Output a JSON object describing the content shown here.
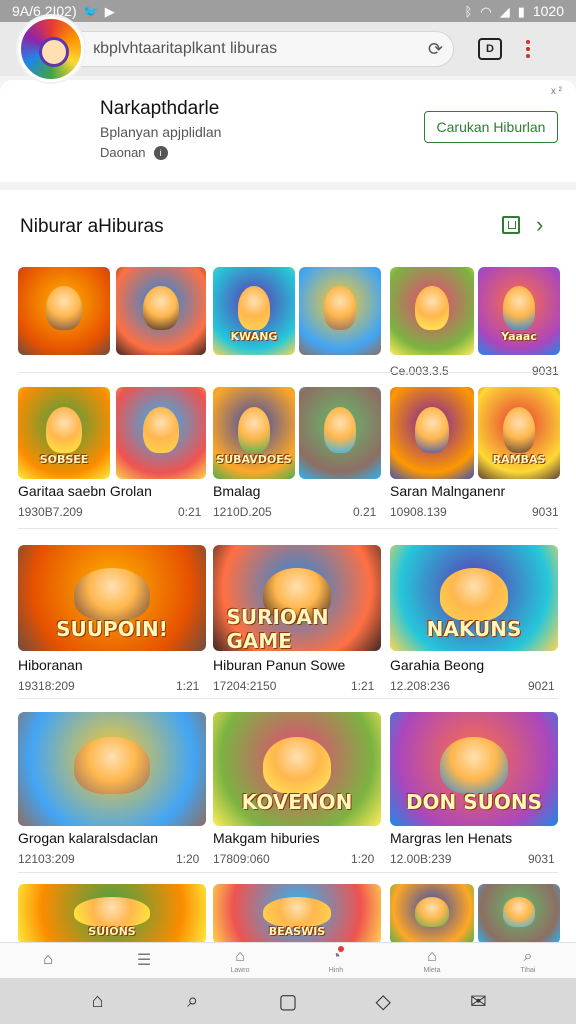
{
  "status_bar": {
    "time": "9A/6 2I02)",
    "right_text": "1020",
    "icons": [
      "twitter-icon",
      "youtube-icon",
      "bluetooth-icon",
      "wifi-icon",
      "signal-icon",
      "battery-icon"
    ]
  },
  "browser": {
    "url_text": "кbplvhtaaritaplkant liburas"
  },
  "app_card": {
    "name": "Narkapthdarle",
    "subtitle": "Bplanyan apjplidlan",
    "meta": "Daonan",
    "install_label": "Carukan Hiburlan",
    "close_mark": "x ²"
  },
  "section": {
    "title": "Niburar aHiburas"
  },
  "rows": [
    {
      "labels": [],
      "metas": [
        {
          "text": "Ce.003.3.5",
          "col": 4
        },
        {
          "text": "9031",
          "col": 5
        }
      ],
      "thumb_text": [
        "",
        "",
        "KWANG",
        "",
        "",
        "Yaaac"
      ]
    },
    {
      "labels": [
        {
          "text": "Garitaa saebn Grolan",
          "col": 0
        },
        {
          "text": "Bmalag",
          "col": 2
        },
        {
          "text": "Saran Malnganenr",
          "col": 4
        }
      ],
      "metas": [
        {
          "text": "1930B7.209",
          "col": 0
        },
        {
          "text": "0:21",
          "col": 1
        },
        {
          "text": "1210D.205",
          "col": 2
        },
        {
          "text": "0.21",
          "col": 3
        },
        {
          "text": "10908.139",
          "col": 4
        },
        {
          "text": "9031",
          "col": 5
        }
      ],
      "thumb_text": [
        "SOBSEE",
        "",
        "SUBAVDOES",
        "",
        "",
        "RAMBAS"
      ]
    },
    {
      "labels": [
        {
          "text": "Hiboranan",
          "col": 0
        },
        {
          "text": "Hiburan Panun Sowe",
          "col": 1
        },
        {
          "text": "Garahia Beong",
          "col": 2
        }
      ],
      "metas": [
        {
          "text": "19318:209",
          "col": 0
        },
        {
          "text": "1:21",
          "col": 0.9
        },
        {
          "text": "17204:2150",
          "col": 1
        },
        {
          "text": "1:21",
          "col": 1.9
        },
        {
          "text": "12.208:236",
          "col": 2
        },
        {
          "text": "9021",
          "col": 2.9
        }
      ],
      "thumb_text": [
        "SUUPOIN!",
        "SURIOAN GAME",
        "NAKUNS"
      ]
    },
    {
      "labels": [
        {
          "text": "Grogan kalaralsdaclan",
          "col": 0
        },
        {
          "text": "Makgam hiburies",
          "col": 1
        },
        {
          "text": "Margras len Henats",
          "col": 2
        }
      ],
      "metas": [
        {
          "text": "12103:209",
          "col": 0
        },
        {
          "text": "1:20",
          "col": 0.9
        },
        {
          "text": "17809:060",
          "col": 1
        },
        {
          "text": "1:20",
          "col": 1.9
        },
        {
          "text": "12.00B:239",
          "col": 2
        },
        {
          "text": "9031",
          "col": 2.9
        }
      ],
      "thumb_text": [
        "",
        "KOVENON",
        "DON SUONS"
      ]
    },
    {
      "labels": [],
      "metas": [],
      "thumb_text": [
        "SUIONS",
        "BEASWIS",
        "",
        ""
      ]
    }
  ],
  "bottom_nav": [
    {
      "icon": "home-icon",
      "label": ""
    },
    {
      "icon": "list-icon",
      "label": ""
    },
    {
      "icon": "bookmark-icon",
      "label": "Lawro"
    },
    {
      "icon": "notifications-icon",
      "label": "Hinh"
    },
    {
      "icon": "apps-icon",
      "label": "Mleta"
    },
    {
      "icon": "search-icon",
      "label": "Tihai"
    }
  ],
  "system_nav": [
    "home-icon",
    "search-icon",
    "square-icon",
    "diamond-icon",
    "mail-icon"
  ]
}
